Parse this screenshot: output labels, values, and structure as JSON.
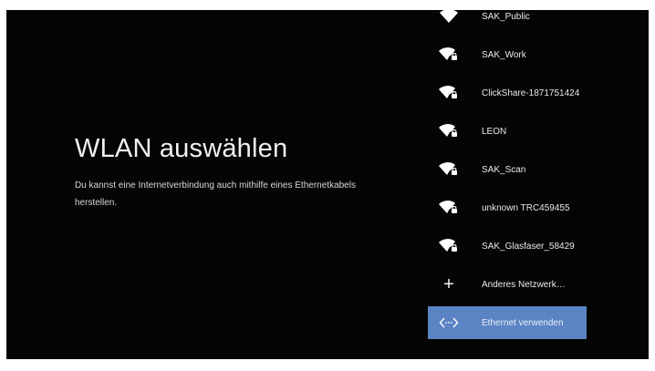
{
  "page": {
    "title": "WLAN auswählen",
    "description": "Du kannst eine Internetverbindung auch mithilfe eines Ethernetkabels herstellen."
  },
  "networks": [
    {
      "label": "SAK_Public",
      "icon": "wifi-icon"
    },
    {
      "label": "SAK_Work",
      "icon": "wifi-lock-icon"
    },
    {
      "label": "ClickShare-1871751424",
      "icon": "wifi-lock-icon"
    },
    {
      "label": "LEON",
      "icon": "wifi-lock-icon"
    },
    {
      "label": "SAK_Scan",
      "icon": "wifi-lock-icon"
    },
    {
      "label": "unknown TRC459455",
      "icon": "wifi-lock-icon"
    },
    {
      "label": "SAK_Glasfaser_58429",
      "icon": "wifi-lock-icon"
    }
  ],
  "actions": {
    "other_network": {
      "label": "Anderes Netzwerk…",
      "icon": "plus-icon"
    },
    "ethernet": {
      "label": "Ethernet verwenden",
      "icon": "ethernet-icon"
    }
  },
  "colors": {
    "background": "#050505",
    "frame": "#ffffff",
    "selected": "#5b84c4",
    "text": "#e9e9e9"
  }
}
